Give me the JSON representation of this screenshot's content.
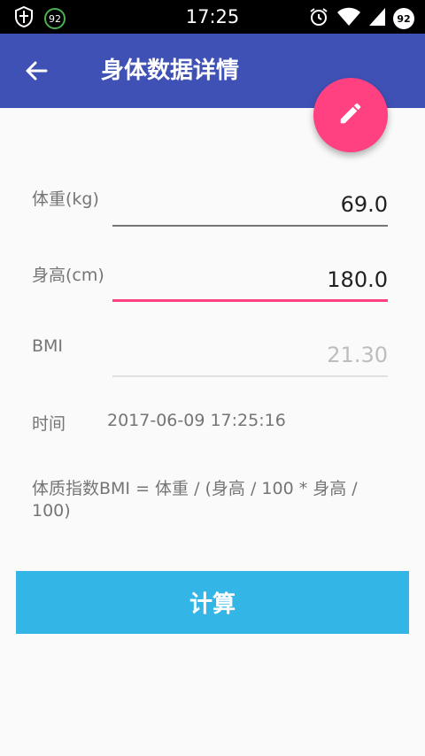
{
  "status_bar": {
    "time": "17:25",
    "left_badge": "92",
    "battery_level": "92",
    "icons": [
      "shield-icon",
      "alarm-icon",
      "wifi-icon",
      "signal-icon",
      "battery-icon"
    ]
  },
  "app_bar": {
    "title": "身体数据详情",
    "back_icon": "arrow-back-icon",
    "color": "#3f51b5"
  },
  "fab": {
    "icon": "edit-pencil-icon",
    "color": "#ff4081"
  },
  "form": {
    "weight": {
      "label": "体重(kg)",
      "value": "69.0"
    },
    "height": {
      "label": "身高(cm)",
      "value": "180.0"
    },
    "bmi": {
      "label": "BMI",
      "value": "21.30"
    },
    "time": {
      "label": "时间",
      "value": "2017-06-09 17:25:16"
    }
  },
  "formula": "体质指数BMI = 体重 / (身高 / 100 * 身高 / 100)",
  "calc_button": {
    "label": "计算",
    "color": "#33b5e5"
  }
}
